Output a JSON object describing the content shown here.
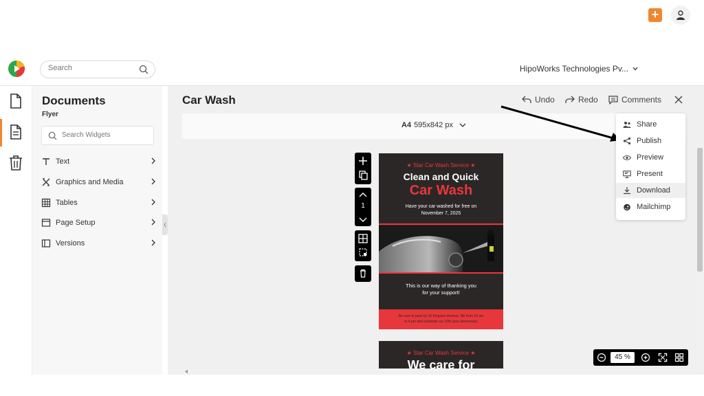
{
  "header": {
    "search_placeholder": "Search",
    "org_name": "HipoWorks Technologies Pv...",
    "add_label": "+"
  },
  "panel": {
    "title": "Documents",
    "subtitle": "Flyer",
    "search_placeholder": "Search Widgets",
    "items": [
      {
        "label": "Text",
        "icon": "text-icon"
      },
      {
        "label": "Graphics and Media",
        "icon": "graphics-icon"
      },
      {
        "label": "Tables",
        "icon": "table-icon"
      },
      {
        "label": "Page Setup",
        "icon": "page-setup-icon"
      },
      {
        "label": "Versions",
        "icon": "versions-icon"
      }
    ]
  },
  "doc": {
    "title": "Car Wash",
    "undo": "Undo",
    "redo": "Redo",
    "comments": "Comments",
    "page_format": "A4",
    "page_dims": "595x842 px"
  },
  "page_nav": {
    "page_number": "1"
  },
  "dropdown": {
    "items": [
      {
        "label": "Share",
        "icon": "share-users-icon"
      },
      {
        "label": "Publish",
        "icon": "publish-share-icon"
      },
      {
        "label": "Preview",
        "icon": "eye-icon"
      },
      {
        "label": "Present",
        "icon": "present-icon"
      },
      {
        "label": "Download",
        "icon": "download-icon"
      },
      {
        "label": "Mailchimp",
        "icon": "mailchimp-icon"
      }
    ],
    "highlighted": "Download"
  },
  "flyer": {
    "brand": "Star Car Wash Service",
    "headline1": "Clean and Quick",
    "headline2": "Car Wash",
    "offer_line1": "Have your car washed for free on",
    "offer_line2": "November 7, 2025",
    "thanks_line1": "This is our way of thanking you",
    "thanks_line2": "for your support!",
    "footer_line1": "Be sure to pass by 16 Kingston Avenue, NE from 10 am",
    "footer_line2": "to 4 pm and celebrate our 10th year anniversary"
  },
  "flyer2": {
    "brand": "Star Car Wash Service",
    "headline": "We care for"
  },
  "zoom": {
    "value": "45",
    "unit": "%"
  },
  "colors": {
    "accent": "#f0862e",
    "flyer_bg": "#2b2726",
    "flyer_red": "#e8373c"
  }
}
